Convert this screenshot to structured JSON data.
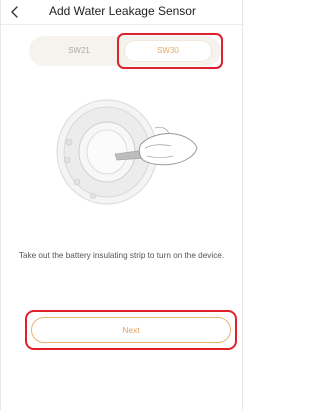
{
  "header": {
    "title": "Add Water Leakage Sensor",
    "back_icon": "chevron-left-icon"
  },
  "tabs": [
    {
      "label": "SW21",
      "selected": false
    },
    {
      "label": "SW30",
      "selected": true
    }
  ],
  "illustration": {
    "icon": "sensor-battery-strip-illustration"
  },
  "instruction": "Take out the battery insulating strip to turn on the device.",
  "next_button": {
    "label": "Next"
  },
  "colors": {
    "accent": "#e3a35d",
    "highlight": "#e0202a",
    "tab_background": "#f6f2ee"
  }
}
